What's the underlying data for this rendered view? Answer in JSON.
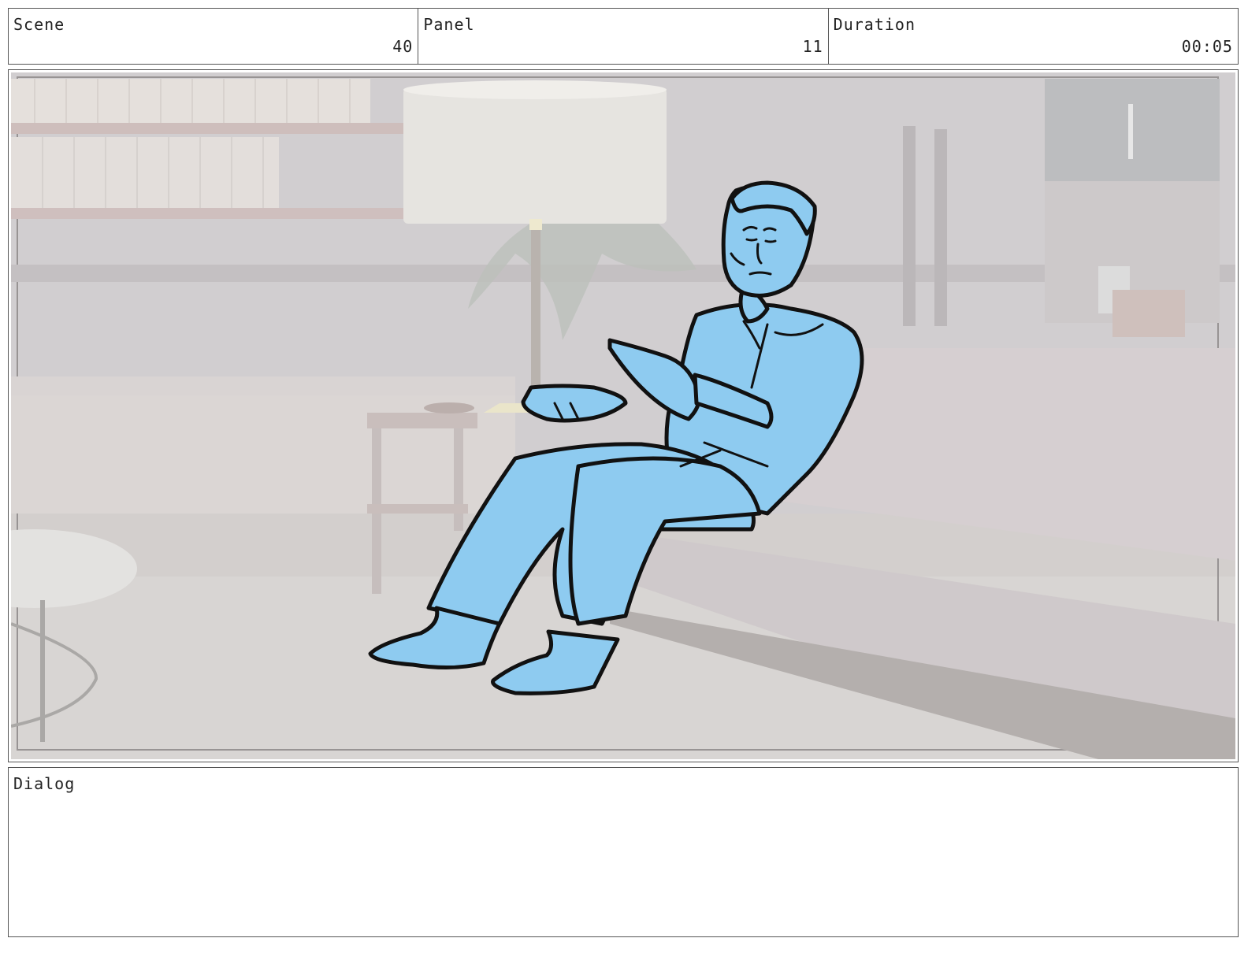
{
  "header": {
    "scene": {
      "label": "Scene",
      "value": "40"
    },
    "panel": {
      "label": "Panel",
      "value": "11"
    },
    "duration": {
      "label": "Duration",
      "value": "00:05"
    }
  },
  "dialog": {
    "label": "Dialog",
    "text": ""
  },
  "colors": {
    "figure_fill": "#8ecbf0",
    "figure_line": "#111111",
    "background_tint": "#cfcbcc"
  }
}
